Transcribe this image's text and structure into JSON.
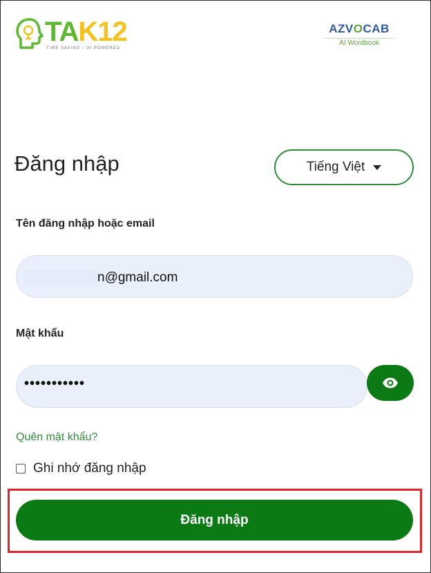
{
  "header": {
    "logo_left": {
      "part1": "TA",
      "part2": "K12",
      "tagline": "TIME SAVING – AI POWERED",
      "icon": "lightbulb-head-icon"
    },
    "logo_right": {
      "part1": "AZV",
      "part2": "O",
      "part3": "CAB",
      "subtitle": "AI Wordbook"
    }
  },
  "login": {
    "title": "Đăng nhập",
    "language": {
      "selected": "Tiếng Việt",
      "icon": "caret-down-icon"
    },
    "username": {
      "label": "Tên đăng nhập hoặc email",
      "value_visible": "n@gmail.com"
    },
    "password": {
      "label": "Mật khẩu",
      "masked_value": "•••••••••••",
      "toggle_icon": "eye-icon"
    },
    "forgot_password": "Quên mật khẩu?",
    "remember_me": {
      "label": "Ghi nhớ đăng nhập",
      "checked": false
    },
    "submit_label": "Đăng nhập"
  },
  "colors": {
    "brand_green": "#0b7a15",
    "link_green": "#2e8b3a",
    "input_bg": "#e9effb",
    "highlight_red": "#e0252b"
  }
}
